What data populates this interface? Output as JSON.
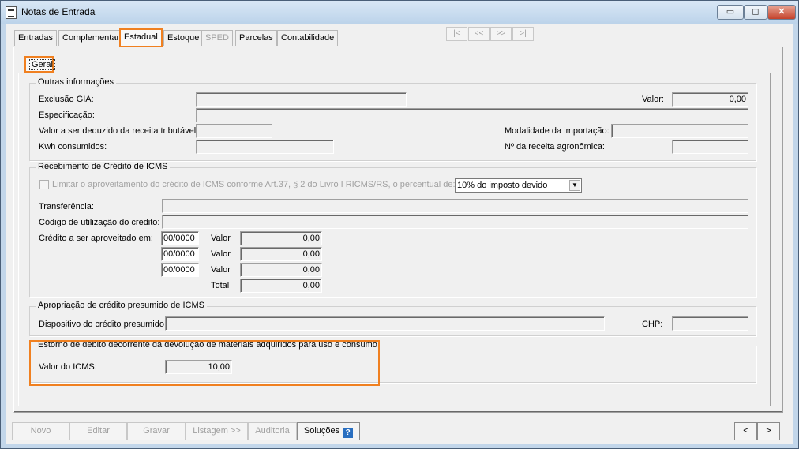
{
  "window": {
    "title": "Notas de Entrada",
    "minimize": "▭",
    "restore": "◻",
    "close": "✕"
  },
  "tabs": [
    {
      "label": "Entradas"
    },
    {
      "label": "Complementar"
    },
    {
      "label": "Estadual"
    },
    {
      "label": "Estoque"
    },
    {
      "label": "SPED"
    },
    {
      "label": "Parcelas"
    },
    {
      "label": "Contabilidade"
    }
  ],
  "nav": {
    "first": "|<",
    "prev": "<<",
    "next": ">>",
    "last": ">|"
  },
  "subtab": "Geral",
  "outras": {
    "legend": "Outras informações",
    "exclusao": "Exclusão GIA:",
    "valor": "Valor:",
    "valor_value": "0,00",
    "especificacao": "Especificação:",
    "deduzido": "Valor a ser deduzido da receita tributável:",
    "modalidade": "Modalidade da importação:",
    "kwh": "Kwh consumidos:",
    "receita": "Nº da receita agronômica:"
  },
  "credito": {
    "legend": "Recebimento de Crédito de ICMS",
    "limitar": "Limitar o aproveitamento do crédito de ICMS conforme Art.37, § 2 do Livro I RICMS/RS, o percentual de:",
    "combo": "10% do imposto devido",
    "transferencia": "Transferência:",
    "codigo": "Código de utilização do crédito:",
    "aproveitado": "Crédito a ser aproveitado em:",
    "rows": [
      {
        "period": "00/0000",
        "label": "Valor",
        "value": "0,00"
      },
      {
        "period": "00/0000",
        "label": "Valor",
        "value": "0,00"
      },
      {
        "period": "00/0000",
        "label": "Valor",
        "value": "0,00"
      }
    ],
    "total_label": "Total",
    "total_value": "0,00"
  },
  "apropriacao": {
    "legend": "Apropriação de crédito presumido de ICMS",
    "dispositivo": "Dispositivo do crédito presumido:",
    "chp": "CHP:"
  },
  "estorno": {
    "legend": "Estorno de débito decorrente da devolução de materiais adquiridos para uso e consumo",
    "valor_icms": "Valor do ICMS:",
    "valor_icms_value": "10,00"
  },
  "buttons": {
    "novo": "Novo",
    "editar": "Editar",
    "gravar": "Gravar",
    "listagem": "Listagem >>",
    "auditoria": "Auditoria",
    "solucoes": "Soluções",
    "help": "?",
    "prev": "<",
    "next": ">"
  },
  "colors": {
    "highlight": "#f08020",
    "window": "#c2d6ea"
  }
}
